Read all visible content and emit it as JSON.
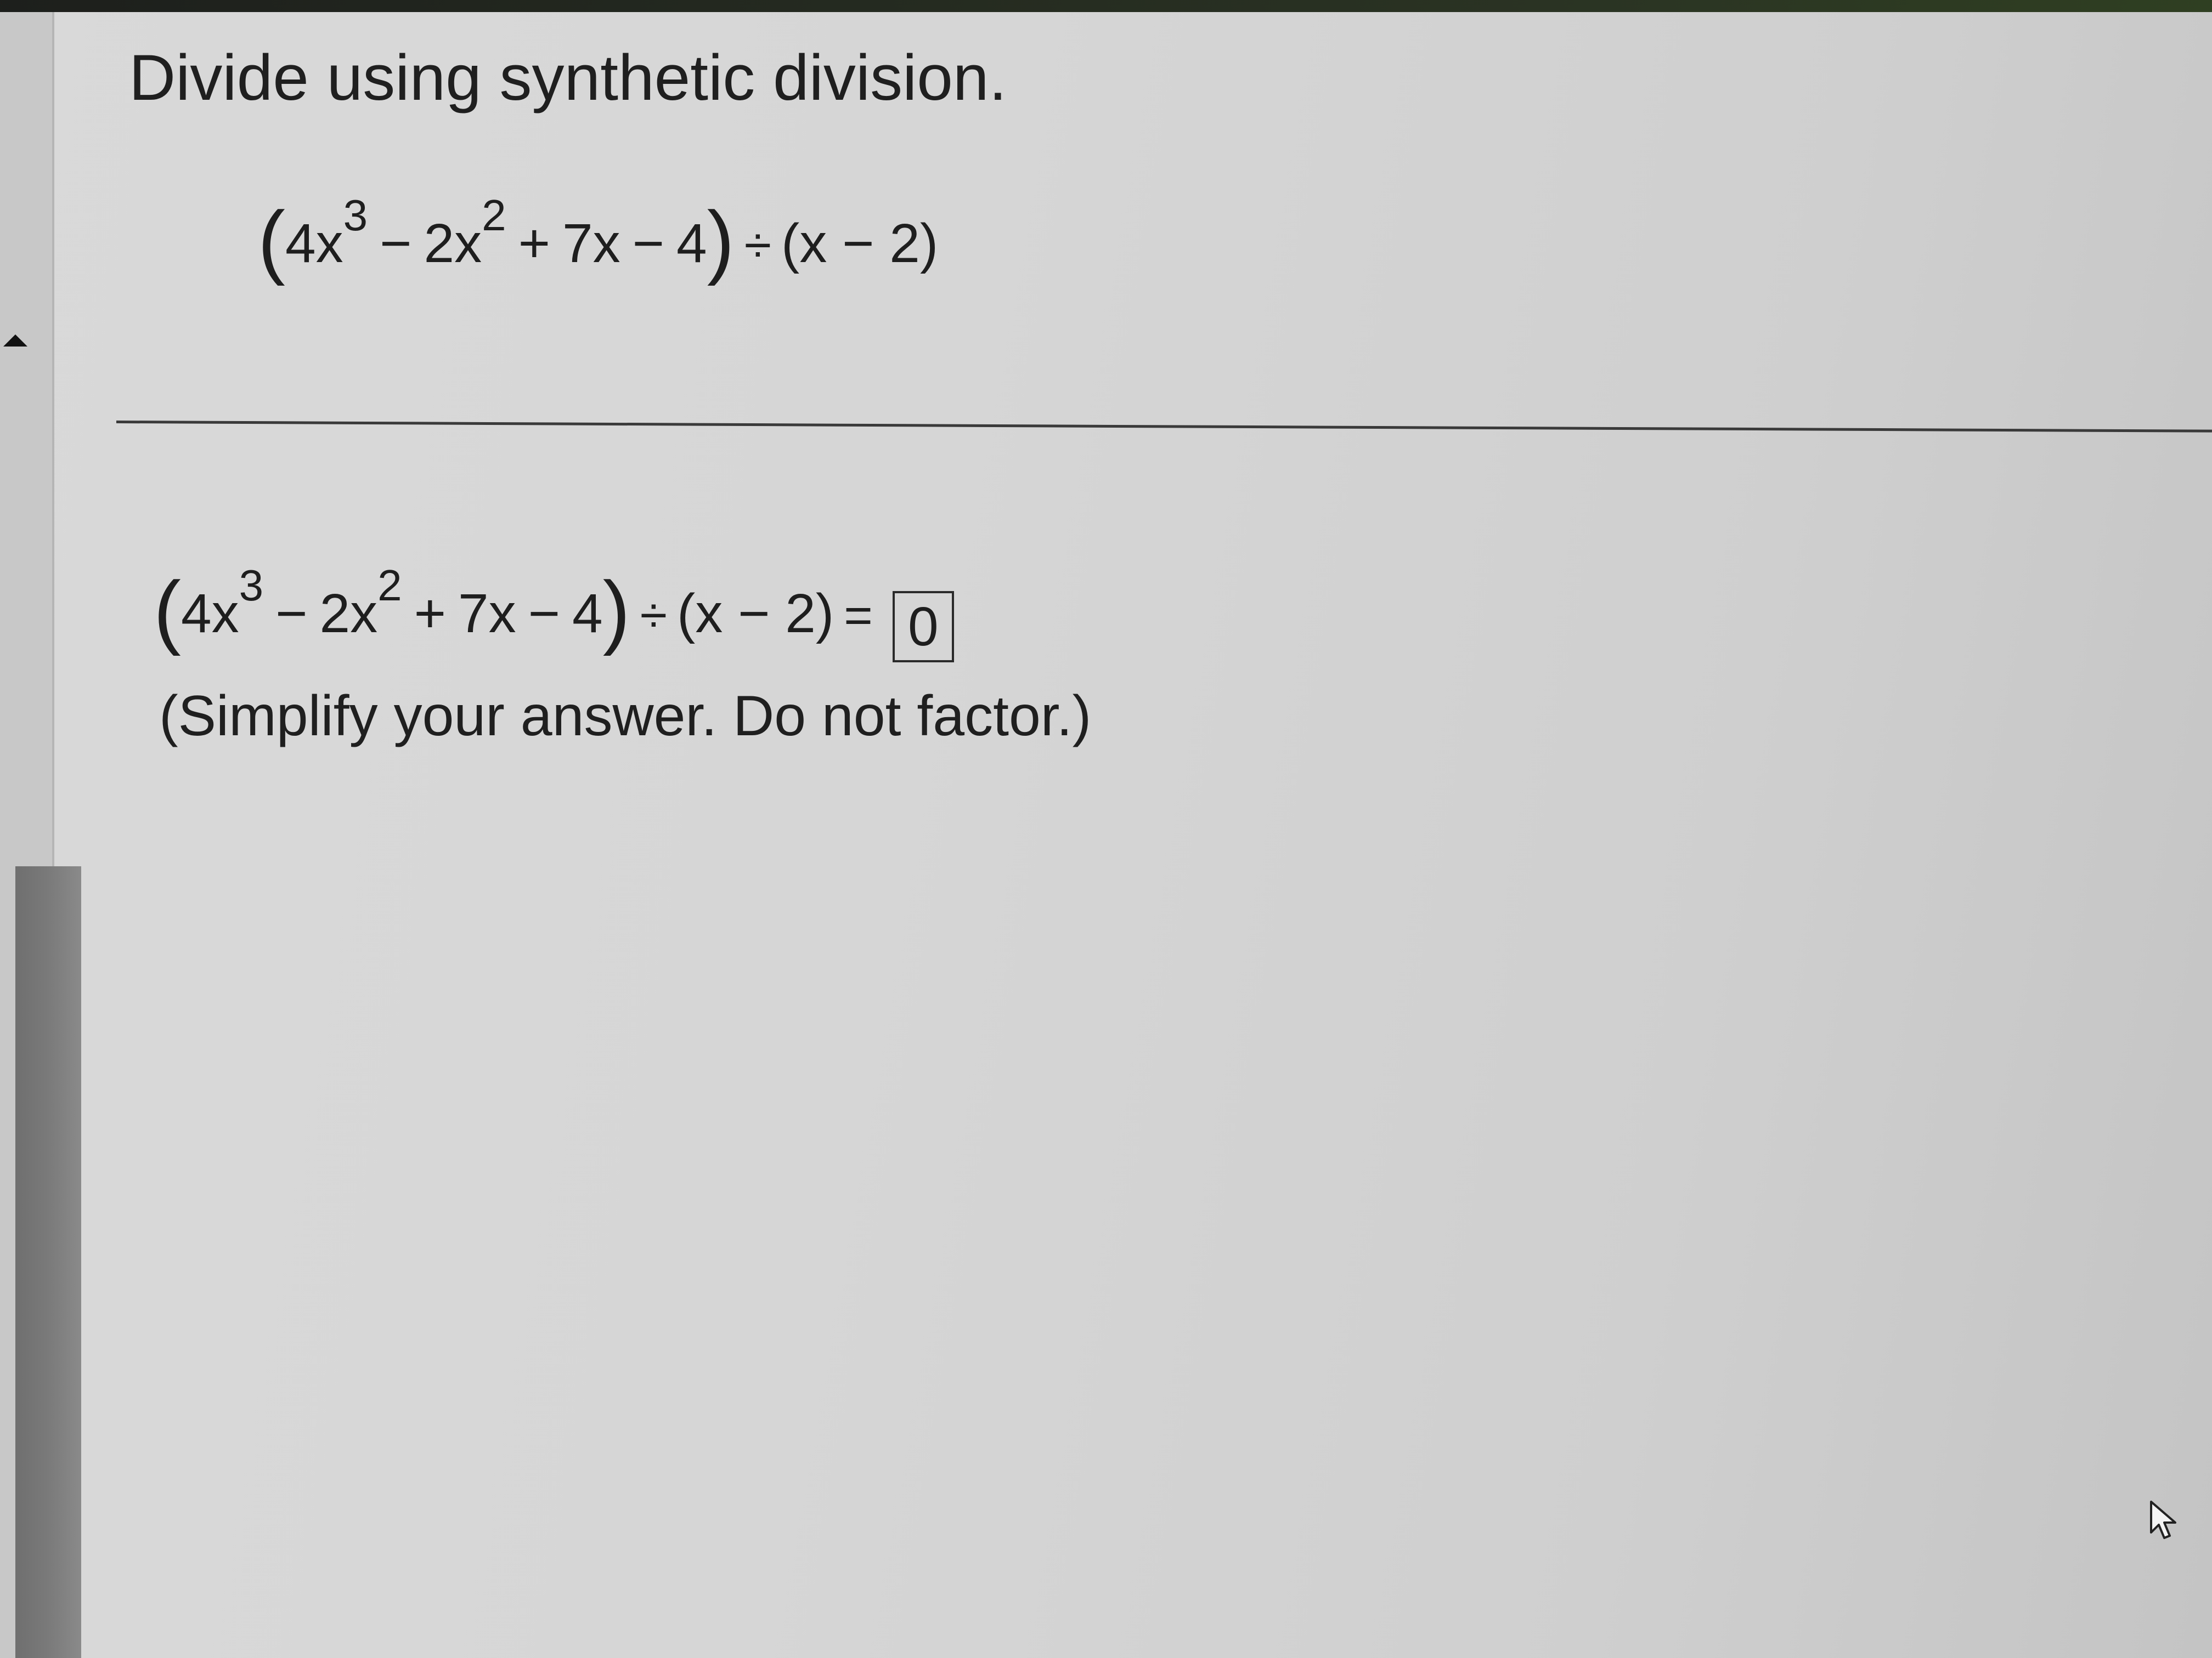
{
  "question": {
    "instruction": "Divide using synthetic division.",
    "problem": {
      "open": "(",
      "t1_coef": "4x",
      "t1_exp": "3",
      "op1": "−",
      "t2_coef": "2x",
      "t2_exp": "2",
      "op2": "+",
      "t3": "7x",
      "op3": "−",
      "t4": "4",
      "close": ")",
      "div": "÷",
      "divisor": "(x − 2)"
    }
  },
  "answer": {
    "lhs": {
      "open": "(",
      "t1_coef": "4x",
      "t1_exp": "3",
      "op1": "−",
      "t2_coef": "2x",
      "t2_exp": "2",
      "op2": "+",
      "t3": "7x",
      "op3": "−",
      "t4": "4",
      "close": ")",
      "div": "÷",
      "divisor": "(x − 2)",
      "equals": "="
    },
    "value": "0",
    "hint": "(Simplify your answer. Do not factor.)"
  },
  "icons": [
    "scroll-up-icon",
    "pointer-cursor-icon"
  ]
}
